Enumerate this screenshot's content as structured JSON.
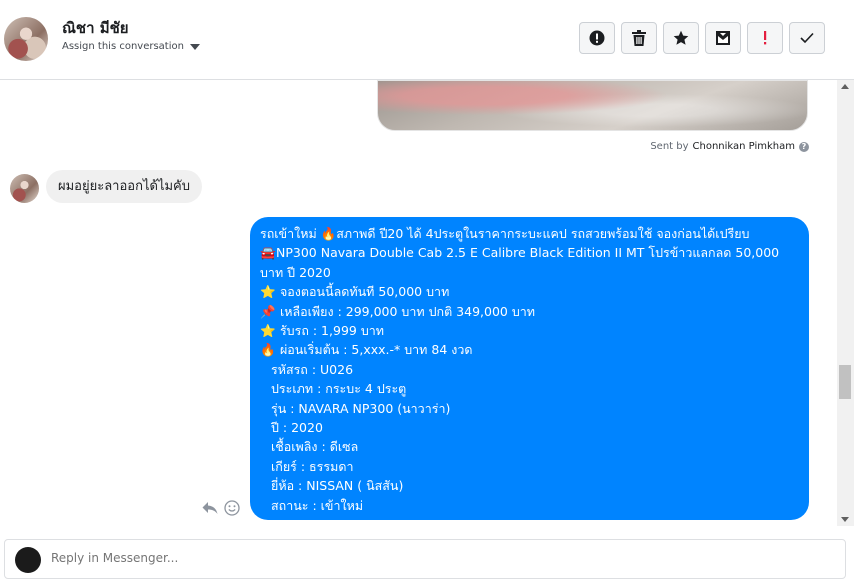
{
  "header": {
    "contact_name": "ณิชา มีชัย",
    "assign_label": "Assign this conversation",
    "action_icons": [
      "alert-circle-icon",
      "trash-icon",
      "star-icon",
      "archive-icon",
      "exclamation-icon",
      "check-icon"
    ],
    "accent_color": "#e41e3f"
  },
  "sent_by": {
    "prefix": "Sent by",
    "name": "Chonnikan Pimkham"
  },
  "incoming_message": "ผมอยู่ยะลาออกได้ไมคับ",
  "outgoing_message": {
    "bubble_color": "#0084ff",
    "lines": [
      {
        "emoji": "",
        "text": "รถเข้าใหม่  🔥สภาพดี ปี20 ได้ 4ประตูในราคากระบะแคป รถสวยพร้อมใช้ จองก่อนได้เปรียบ"
      },
      {
        "emoji": "🚘",
        "text": "NP300 Navara Double Cab 2.5 E Calibre Black Edition II MT โปรข้าวแลกลด 50,000"
      },
      {
        "emoji": "",
        "text": "บาท ปี 2020"
      },
      {
        "emoji": "⭐",
        "text": " จองตอนนี้ลดทันที 50,000 บาท"
      },
      {
        "emoji": "📌",
        "text": " เหลือเพียง : 299,000 บาท ปกติ 349,000 บาท"
      },
      {
        "emoji": "⭐",
        "text": " รับรถ : 1,999 บาท"
      },
      {
        "emoji": "🔥",
        "text": " ผ่อนเริ่มต้น : 5,xxx.-* บาท 84 งวด"
      },
      {
        "emoji": "",
        "text": "รหัสรถ : U026",
        "indent": true
      },
      {
        "emoji": "",
        "text": "ประเภท : กระบะ 4 ประตู",
        "indent": true
      },
      {
        "emoji": "",
        "text": "รุ่น : NAVARA NP300 (นาวาร่า)",
        "indent": true
      },
      {
        "emoji": "",
        "text": "ปี : 2020",
        "indent": true
      },
      {
        "emoji": "",
        "text": "เชื้อเพลิง : ดีเซล",
        "indent": true
      },
      {
        "emoji": "",
        "text": "เกียร์ : ธรรมดา",
        "indent": true
      },
      {
        "emoji": "",
        "text": "ยี่ห้อ : NISSAN ( นิสสัน)",
        "indent": true
      },
      {
        "emoji": "",
        "text": "สถานะ : เข้าใหม่",
        "indent": true
      }
    ]
  },
  "composer": {
    "placeholder": "Reply in Messenger..."
  }
}
